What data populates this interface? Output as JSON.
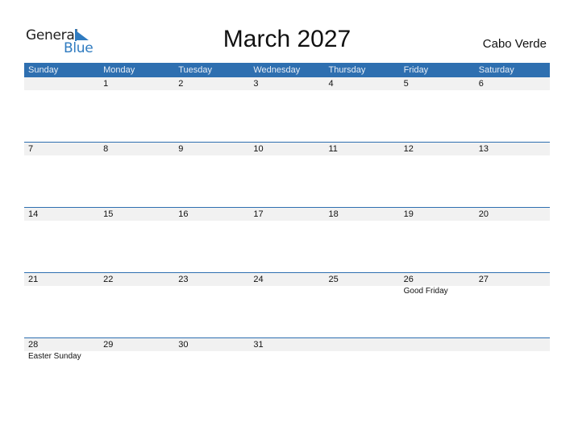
{
  "logo": {
    "general": "General",
    "blue": "Blue"
  },
  "title": "March 2027",
  "country": "Cabo Verde",
  "colors": {
    "header": "#2e6fb0",
    "date_row": "#f1f1f1",
    "logo_blue": "#2f7bc0"
  },
  "weekdays": [
    "Sunday",
    "Monday",
    "Tuesday",
    "Wednesday",
    "Thursday",
    "Friday",
    "Saturday"
  ],
  "weeks": [
    {
      "dates": [
        "",
        "1",
        "2",
        "3",
        "4",
        "5",
        "6"
      ],
      "events": [
        "",
        "",
        "",
        "",
        "",
        "",
        ""
      ]
    },
    {
      "dates": [
        "7",
        "8",
        "9",
        "10",
        "11",
        "12",
        "13"
      ],
      "events": [
        "",
        "",
        "",
        "",
        "",
        "",
        ""
      ]
    },
    {
      "dates": [
        "14",
        "15",
        "16",
        "17",
        "18",
        "19",
        "20"
      ],
      "events": [
        "",
        "",
        "",
        "",
        "",
        "",
        ""
      ]
    },
    {
      "dates": [
        "21",
        "22",
        "23",
        "24",
        "25",
        "26",
        "27"
      ],
      "events": [
        "",
        "",
        "",
        "",
        "",
        "Good Friday",
        ""
      ]
    },
    {
      "dates": [
        "28",
        "29",
        "30",
        "31",
        "",
        "",
        ""
      ],
      "events": [
        "Easter Sunday",
        "",
        "",
        "",
        "",
        "",
        ""
      ]
    }
  ]
}
